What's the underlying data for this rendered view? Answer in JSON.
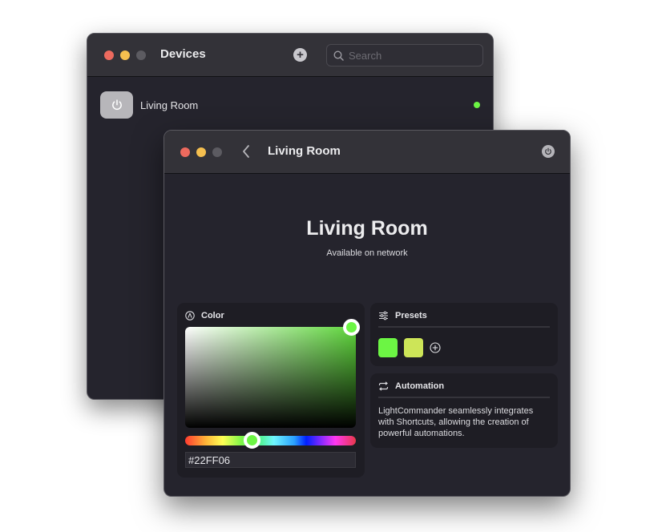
{
  "devices_window": {
    "title": "Devices",
    "search": {
      "placeholder": "Search",
      "value": ""
    },
    "devices": [
      {
        "name": "Living Room",
        "status": "online",
        "status_color": "#6cf544"
      }
    ]
  },
  "detail_window": {
    "title": "Living Room",
    "hero": {
      "title": "Living Room",
      "subtitle": "Available on network"
    },
    "color_panel": {
      "label": "Color",
      "hex_value": "#22FF06",
      "selected_color": "#6cf544"
    },
    "presets_panel": {
      "label": "Presets",
      "presets": [
        {
          "color": "#6cf544"
        },
        {
          "color": "#cde558"
        }
      ]
    },
    "automation_panel": {
      "label": "Automation",
      "description": "LightCommander seamlessly integrates with Shortcuts, allowing the creation of powerful automations."
    }
  }
}
